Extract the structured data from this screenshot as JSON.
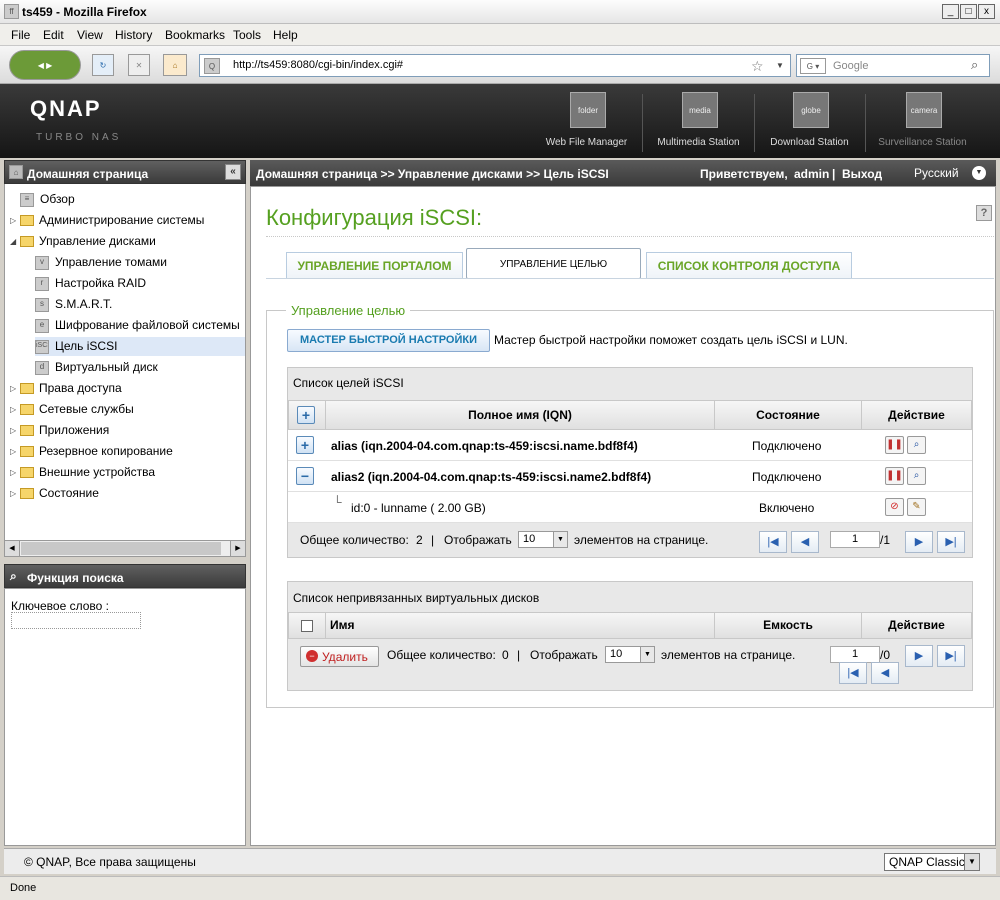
{
  "window": {
    "title": "ts459 - Mozilla Firefox"
  },
  "menu": [
    "File",
    "Edit",
    "View",
    "History",
    "Bookmarks",
    "Tools",
    "Help"
  ],
  "nav": {
    "url": "http://ts459:8080/cgi-bin/index.cgi#",
    "search_placeholder": "Google"
  },
  "banner": {
    "logo": "QNAP",
    "logo_sub": "TURBO NAS",
    "apps": [
      "Web File Manager",
      "Multimedia Station",
      "Download Station",
      "Surveillance Station"
    ]
  },
  "left": {
    "header": "Домашняя страница",
    "tree": [
      {
        "label": "Обзор"
      },
      {
        "label": "Администрирование системы"
      },
      {
        "label": "Управление дисками"
      },
      {
        "label": "Управление томами"
      },
      {
        "label": "Настройка RAID"
      },
      {
        "label": "S.M.A.R.T."
      },
      {
        "label": "Шифрование файловой системы"
      },
      {
        "label": "Цель iSCSI"
      },
      {
        "label": "Виртуальный диск"
      },
      {
        "label": "Права доступа"
      },
      {
        "label": "Сетевые службы"
      },
      {
        "label": "Приложения"
      },
      {
        "label": "Резервное копирование"
      },
      {
        "label": "Внешние устройства"
      },
      {
        "label": "Состояние"
      }
    ],
    "search_header": "Функция поиска",
    "keyword_label": "Ключевое слово :",
    "iscsi_tag": "iSCSI"
  },
  "top": {
    "breadcrumb": "Домашняя страница >> Управление дисками >> Цель iSCSI",
    "greeting": "Приветствуем,",
    "user": "admin",
    "divider": "|",
    "logout": "Выход",
    "language": "Русский"
  },
  "page": {
    "title": "Конфигурация iSCSI:",
    "help": "?",
    "tabs": [
      "УПРАВЛЕНИЕ ПОРТАЛОМ",
      "УПРАВЛЕНИЕ ЦЕЛЬЮ",
      "СПИСОК КОНТРОЛЯ ДОСТУПА"
    ],
    "section": "Управление целью",
    "wizard_button": "МАСТЕР БЫСТРОЙ НАСТРОЙКИ",
    "wizard_text": "Мастер быстрой настройки поможет создать цель iSCSI и LUN."
  },
  "targets": {
    "title": "Список целей iSCSI",
    "columns": [
      "Полное имя (IQN)",
      "Состояние",
      "Действие"
    ],
    "rows": [
      {
        "name": "alias (iqn.2004-04.com.qnap:ts-459:iscsi.name.bdf8f4)",
        "state": "Подключено"
      },
      {
        "name": "alias2 (iqn.2004-04.com.qnap:ts-459:iscsi.name2.bdf8f4)",
        "state": "Подключено"
      },
      {
        "name": "id:0 - lunname ( 2.00 GB)",
        "state": "Включено"
      }
    ],
    "total_label": "Общее количество:",
    "total": "2",
    "sep": "|",
    "show_label": "Отображать",
    "per_page": "10",
    "per_page_suffix": "элементов на странице.",
    "page": "1",
    "pages": "/1"
  },
  "vdisks": {
    "title": "Список непривязанных виртуальных дисков",
    "columns": [
      "Имя",
      "Емкость",
      "Действие"
    ],
    "delete_button": "Удалить",
    "total_label": "Общее количество:",
    "total": "0",
    "sep": "|",
    "show_label": "Отображать",
    "per_page": "10",
    "per_page_suffix": "элементов на странице.",
    "page": "1",
    "pages": "/0"
  },
  "footer": {
    "copyright": "© QNAP, Все права защищены",
    "theme": "QNAP Classic"
  },
  "status": "Done",
  "icons": {
    "plus": "+",
    "minus": "−",
    "tree_branch": "└",
    "pager_first": "|◀",
    "pager_prev": "◀",
    "pager_next": "▶",
    "pager_last": "▶|"
  }
}
